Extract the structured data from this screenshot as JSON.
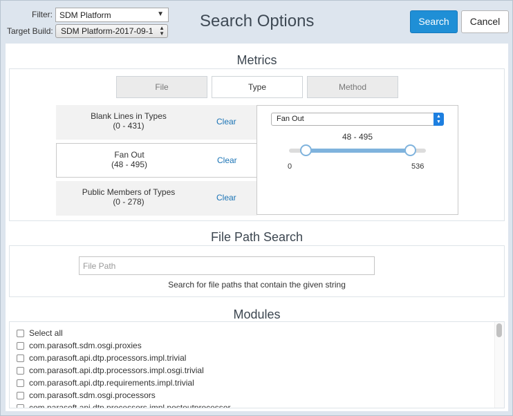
{
  "header": {
    "filter_label": "Filter:",
    "filter_value": "SDM Platform",
    "build_label": "Target Build:",
    "build_value": "SDM Platform-2017-09-1",
    "title": "Search Options",
    "search_button": "Search",
    "cancel_button": "Cancel"
  },
  "metrics": {
    "section_title": "Metrics",
    "tabs": [
      {
        "label": "File",
        "active": false
      },
      {
        "label": "Type",
        "active": true
      },
      {
        "label": "Method",
        "active": false
      }
    ],
    "rows": [
      {
        "name": "Blank Lines in Types",
        "range": "(0 - 431)",
        "clear": "Clear"
      },
      {
        "name": "Fan Out",
        "range": "(48 - 495)",
        "clear": "Clear"
      },
      {
        "name": "Public Members of Types",
        "range": "(0 - 278)",
        "clear": "Clear"
      }
    ],
    "detail": {
      "selected_metric": "Fan Out",
      "range_text": "48 - 495",
      "min": "0",
      "max": "536",
      "low_value": 48,
      "high_value": 495,
      "scale_max": 536
    }
  },
  "file_path": {
    "section_title": "File Path Search",
    "placeholder": "File Path",
    "help": "Search for file paths that contain the given string"
  },
  "modules": {
    "section_title": "Modules",
    "items": [
      "Select all",
      "com.parasoft.sdm.osgi.proxies",
      "com.parasoft.api.dtp.processors.impl.trivial",
      "com.parasoft.api.dtp.processors.impl.osgi.trivial",
      "com.parasoft.api.dtp.requirements.impl.trivial",
      "com.parasoft.sdm.osgi.processors",
      "com.parasoft.api.dtp.processors.impl.postoutprocessor"
    ]
  },
  "colors": {
    "accent": "#1f8fd6",
    "link": "#1a73b5",
    "slider": "#7fb3dd"
  }
}
